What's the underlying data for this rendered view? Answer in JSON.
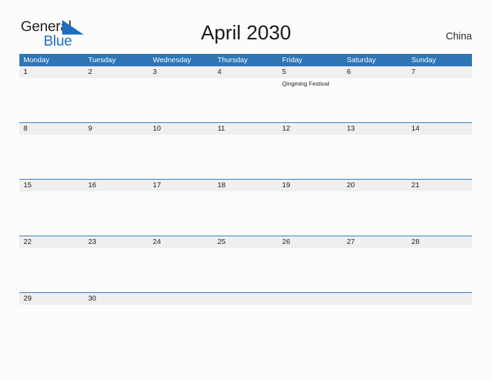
{
  "brand": {
    "name_part1": "General",
    "name_part2": "Blue",
    "flag_icon": "triangle-flag-icon",
    "color_dark": "#231f20",
    "color_blue": "#1f6fc0"
  },
  "header": {
    "title": "April 2030",
    "country": "China"
  },
  "calendar": {
    "accent_color": "#2e75b6",
    "band_color": "#efefef",
    "weekdays": [
      "Monday",
      "Tuesday",
      "Wednesday",
      "Thursday",
      "Friday",
      "Saturday",
      "Sunday"
    ],
    "weeks": [
      {
        "days": [
          {
            "date": "1",
            "events": []
          },
          {
            "date": "2",
            "events": []
          },
          {
            "date": "3",
            "events": []
          },
          {
            "date": "4",
            "events": []
          },
          {
            "date": "5",
            "events": [
              "Qingming Festival"
            ]
          },
          {
            "date": "6",
            "events": []
          },
          {
            "date": "7",
            "events": []
          }
        ]
      },
      {
        "days": [
          {
            "date": "8",
            "events": []
          },
          {
            "date": "9",
            "events": []
          },
          {
            "date": "10",
            "events": []
          },
          {
            "date": "11",
            "events": []
          },
          {
            "date": "12",
            "events": []
          },
          {
            "date": "13",
            "events": []
          },
          {
            "date": "14",
            "events": []
          }
        ]
      },
      {
        "days": [
          {
            "date": "15",
            "events": []
          },
          {
            "date": "16",
            "events": []
          },
          {
            "date": "17",
            "events": []
          },
          {
            "date": "18",
            "events": []
          },
          {
            "date": "19",
            "events": []
          },
          {
            "date": "20",
            "events": []
          },
          {
            "date": "21",
            "events": []
          }
        ]
      },
      {
        "days": [
          {
            "date": "22",
            "events": []
          },
          {
            "date": "23",
            "events": []
          },
          {
            "date": "24",
            "events": []
          },
          {
            "date": "25",
            "events": []
          },
          {
            "date": "26",
            "events": []
          },
          {
            "date": "27",
            "events": []
          },
          {
            "date": "28",
            "events": []
          }
        ]
      },
      {
        "days": [
          {
            "date": "29",
            "events": []
          },
          {
            "date": "30",
            "events": []
          },
          {
            "date": "",
            "events": []
          },
          {
            "date": "",
            "events": []
          },
          {
            "date": "",
            "events": []
          },
          {
            "date": "",
            "events": []
          },
          {
            "date": "",
            "events": []
          }
        ]
      }
    ]
  }
}
